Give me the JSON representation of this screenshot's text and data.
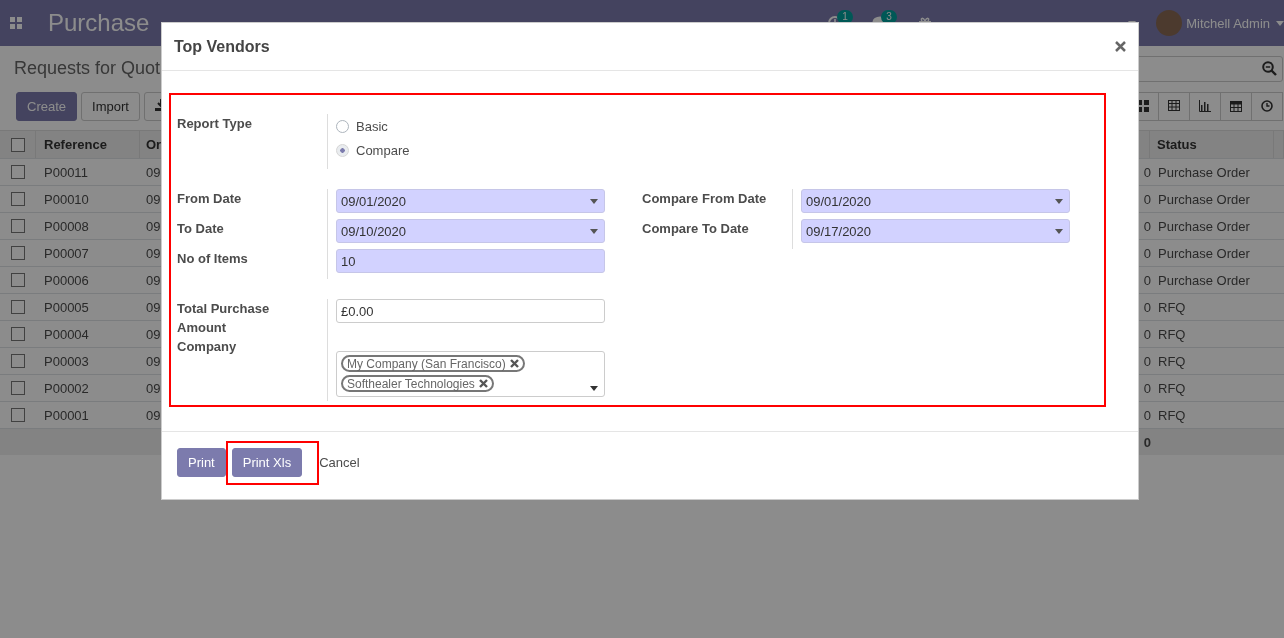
{
  "navbar": {
    "app_title": "Purchase",
    "activity_count": "1",
    "message_count": "3",
    "user": "Mitchell Admin"
  },
  "control_panel": {
    "breadcrumb": "Requests for Quot",
    "buttons": [
      "Create",
      "Import"
    ]
  },
  "table": {
    "select_all_checked": false,
    "columns": [
      "Reference",
      "Or",
      "Status"
    ],
    "footer_total": "0",
    "rows": [
      {
        "checked": false,
        "reference": "P00011",
        "column_2": "09",
        "column_4": "0",
        "status": "Purchase Order"
      },
      {
        "checked": false,
        "reference": "P00010",
        "column_2": "09",
        "column_4": "0",
        "status": "Purchase Order"
      },
      {
        "checked": false,
        "reference": "P00008",
        "column_2": "09",
        "column_4": "0",
        "status": "Purchase Order"
      },
      {
        "checked": false,
        "reference": "P00007",
        "column_2": "09",
        "column_4": "0",
        "status": "Purchase Order"
      },
      {
        "checked": false,
        "reference": "P00006",
        "column_2": "09",
        "column_4": "0",
        "status": "Purchase Order"
      },
      {
        "checked": false,
        "reference": "P00005",
        "column_2": "09",
        "column_4": "0",
        "status": "RFQ"
      },
      {
        "checked": false,
        "reference": "P00004",
        "column_2": "09",
        "column_4": "0",
        "status": "RFQ"
      },
      {
        "checked": false,
        "reference": "P00003",
        "column_2": "09",
        "column_4": "0",
        "status": "RFQ"
      },
      {
        "checked": false,
        "reference": "P00002",
        "column_2": "09",
        "column_4": "0",
        "status": "RFQ"
      },
      {
        "checked": false,
        "reference": "P00001",
        "column_2": "09",
        "column_4": "0",
        "status": "RFQ"
      }
    ]
  },
  "dialog": {
    "title": "Top Vendors",
    "form_highlighted": true,
    "report_type": {
      "label": "Report Type",
      "options": [
        {
          "label": "Basic",
          "selected": false
        },
        {
          "label": "Compare",
          "selected": true
        }
      ]
    },
    "date_fields": [
      {
        "label": "From Date",
        "value": "09/01/2020",
        "kind": "date",
        "required": true
      },
      {
        "label": "To Date",
        "value": "09/10/2020",
        "kind": "date",
        "required": true
      },
      {
        "label": "No of Items",
        "value": "10",
        "kind": "text",
        "required": true
      }
    ],
    "compare_fields": [
      {
        "label": "Compare From Date",
        "value": "09/01/2020",
        "kind": "date",
        "required": true
      },
      {
        "label": "Compare To Date",
        "value": "09/17/2020",
        "kind": "date",
        "required": true
      }
    ],
    "other_fields": [
      {
        "label": "Total Purchase Amount",
        "value": "£0.00",
        "kind": "text",
        "required": false
      },
      {
        "label": "Company",
        "kind": "tags",
        "required": false,
        "tags": [
          "My Company (San Francisco)",
          "Softhealer Technologies"
        ]
      }
    ],
    "buttons": [
      {
        "label": "Print",
        "kind": "primary",
        "highlighted": false
      },
      {
        "label": "Print Xls",
        "kind": "primary",
        "highlighted": true
      },
      {
        "label": "Cancel",
        "kind": "link",
        "highlighted": false
      }
    ]
  }
}
